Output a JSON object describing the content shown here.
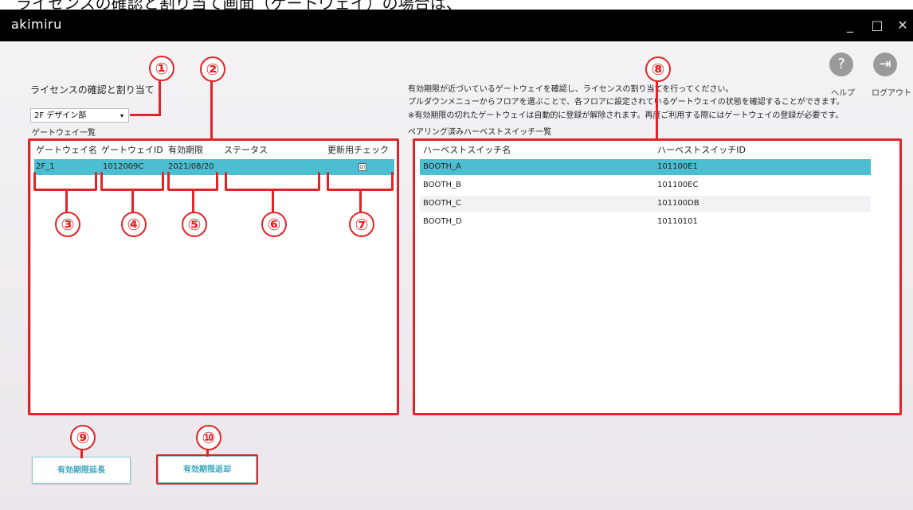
{
  "top_caption": "ライセンスの確認と割り当て画面（ゲートウェイ）の場合は、",
  "window": {
    "title": "akimiru",
    "minimize": "_",
    "maximize": "□",
    "close": "✕"
  },
  "header": {
    "help_label": "ヘルプ",
    "logout_label": "ログアウト",
    "help_icon_glyph": "?",
    "logout_icon_glyph": "⇥"
  },
  "left": {
    "heading": "ライセンスの確認と割り当て",
    "floor_select": {
      "value": "2F デザイン部",
      "arrow": "▾"
    },
    "list_title": "ゲートウェイ一覧",
    "columns": [
      "ゲートウェイ名",
      "ゲートウェイID",
      "有効期限",
      "ステータス",
      "更新用チェック"
    ],
    "rows": [
      {
        "name": "2F_1",
        "id": "1012009C",
        "expiry": "2021/08/20",
        "status": "",
        "checked": "☑"
      }
    ]
  },
  "right": {
    "info_lines": [
      "有効期限が近づいているゲートウェイを確認し、ライセンスの割り当てを行ってください。",
      "プルダウンメニューからフロアを選ぶことで、各フロアに設定されているゲートウェイの状態を確認することができます。",
      "※有効期限の切れたゲートウェイは自動的に登録が解除されます。再度ご利用する際にはゲートウェイの登録が必要です。"
    ],
    "list_title": "ペアリング済みハーベストスイッチ一覧",
    "columns": [
      "ハーベストスイッチ名",
      "ハーベストスイッチID"
    ],
    "rows": [
      {
        "name": "BOOTH_A",
        "id": "101100E1"
      },
      {
        "name": "BOOTH_B",
        "id": "101100EC"
      },
      {
        "name": "BOOTH_C",
        "id": "101100DB"
      },
      {
        "name": "BOOTH_D",
        "id": "10110101"
      }
    ]
  },
  "buttons": {
    "extend": "有効期限延長",
    "return": "有効期限返却"
  },
  "markers": [
    "①",
    "②",
    "③",
    "④",
    "⑤",
    "⑥",
    "⑦",
    "⑧",
    "⑨",
    "⑩"
  ],
  "colors": {
    "highlight": "#e42326",
    "selected_row": "#4bbfd1",
    "button_text": "#3aa6be"
  }
}
